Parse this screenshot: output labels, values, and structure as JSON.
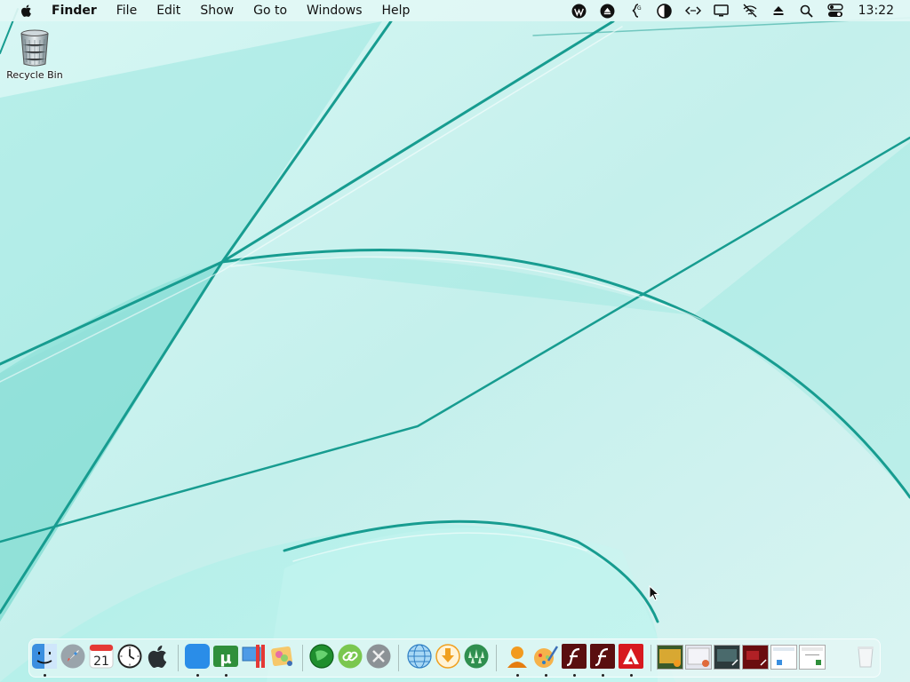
{
  "menubar": {
    "app_name": "Finder",
    "menus": [
      "File",
      "Edit",
      "Show",
      "Go to",
      "Windows",
      "Help"
    ],
    "tray_icons": [
      "wordpress-icon",
      "eject-circle-icon",
      "code-brackets-icon",
      "contrast-icon",
      "network-arrows-icon",
      "display-icon",
      "no-wifi-icon",
      "eject-icon",
      "search-icon",
      "control-center-icon"
    ],
    "clock": "13:22"
  },
  "desktop": {
    "icons": [
      {
        "label": "Recycle Bin",
        "icon": "trash-icon"
      }
    ]
  },
  "dock": {
    "calendar_day": "21",
    "apps": [
      "finder-icon",
      "launchpad-icon",
      "calendar-icon",
      "clock-icon",
      "apple-icon",
      "safari-icon",
      "utorrent-icon",
      "parallels-icon",
      "photo-editor-icon",
      "green-globe-icon",
      "link-icon",
      "tools-icon",
      "web-globe-icon",
      "download-icon",
      "grid-dots-icon",
      "contacts-icon",
      "paint-icon",
      "flash-icon",
      "flash-icon-2",
      "adobe-icon",
      "window-thumbnail-1",
      "window-thumbnail-2",
      "window-thumbnail-3",
      "window-thumbnail-4",
      "window-thumbnail-5",
      "window-thumbnail-6",
      "trash-icon"
    ]
  },
  "colors": {
    "wallpaper_base": "#c9f2ee",
    "wallpaper_stroke": "#1aa598",
    "menubar_bg": "#e2f7f5"
  }
}
